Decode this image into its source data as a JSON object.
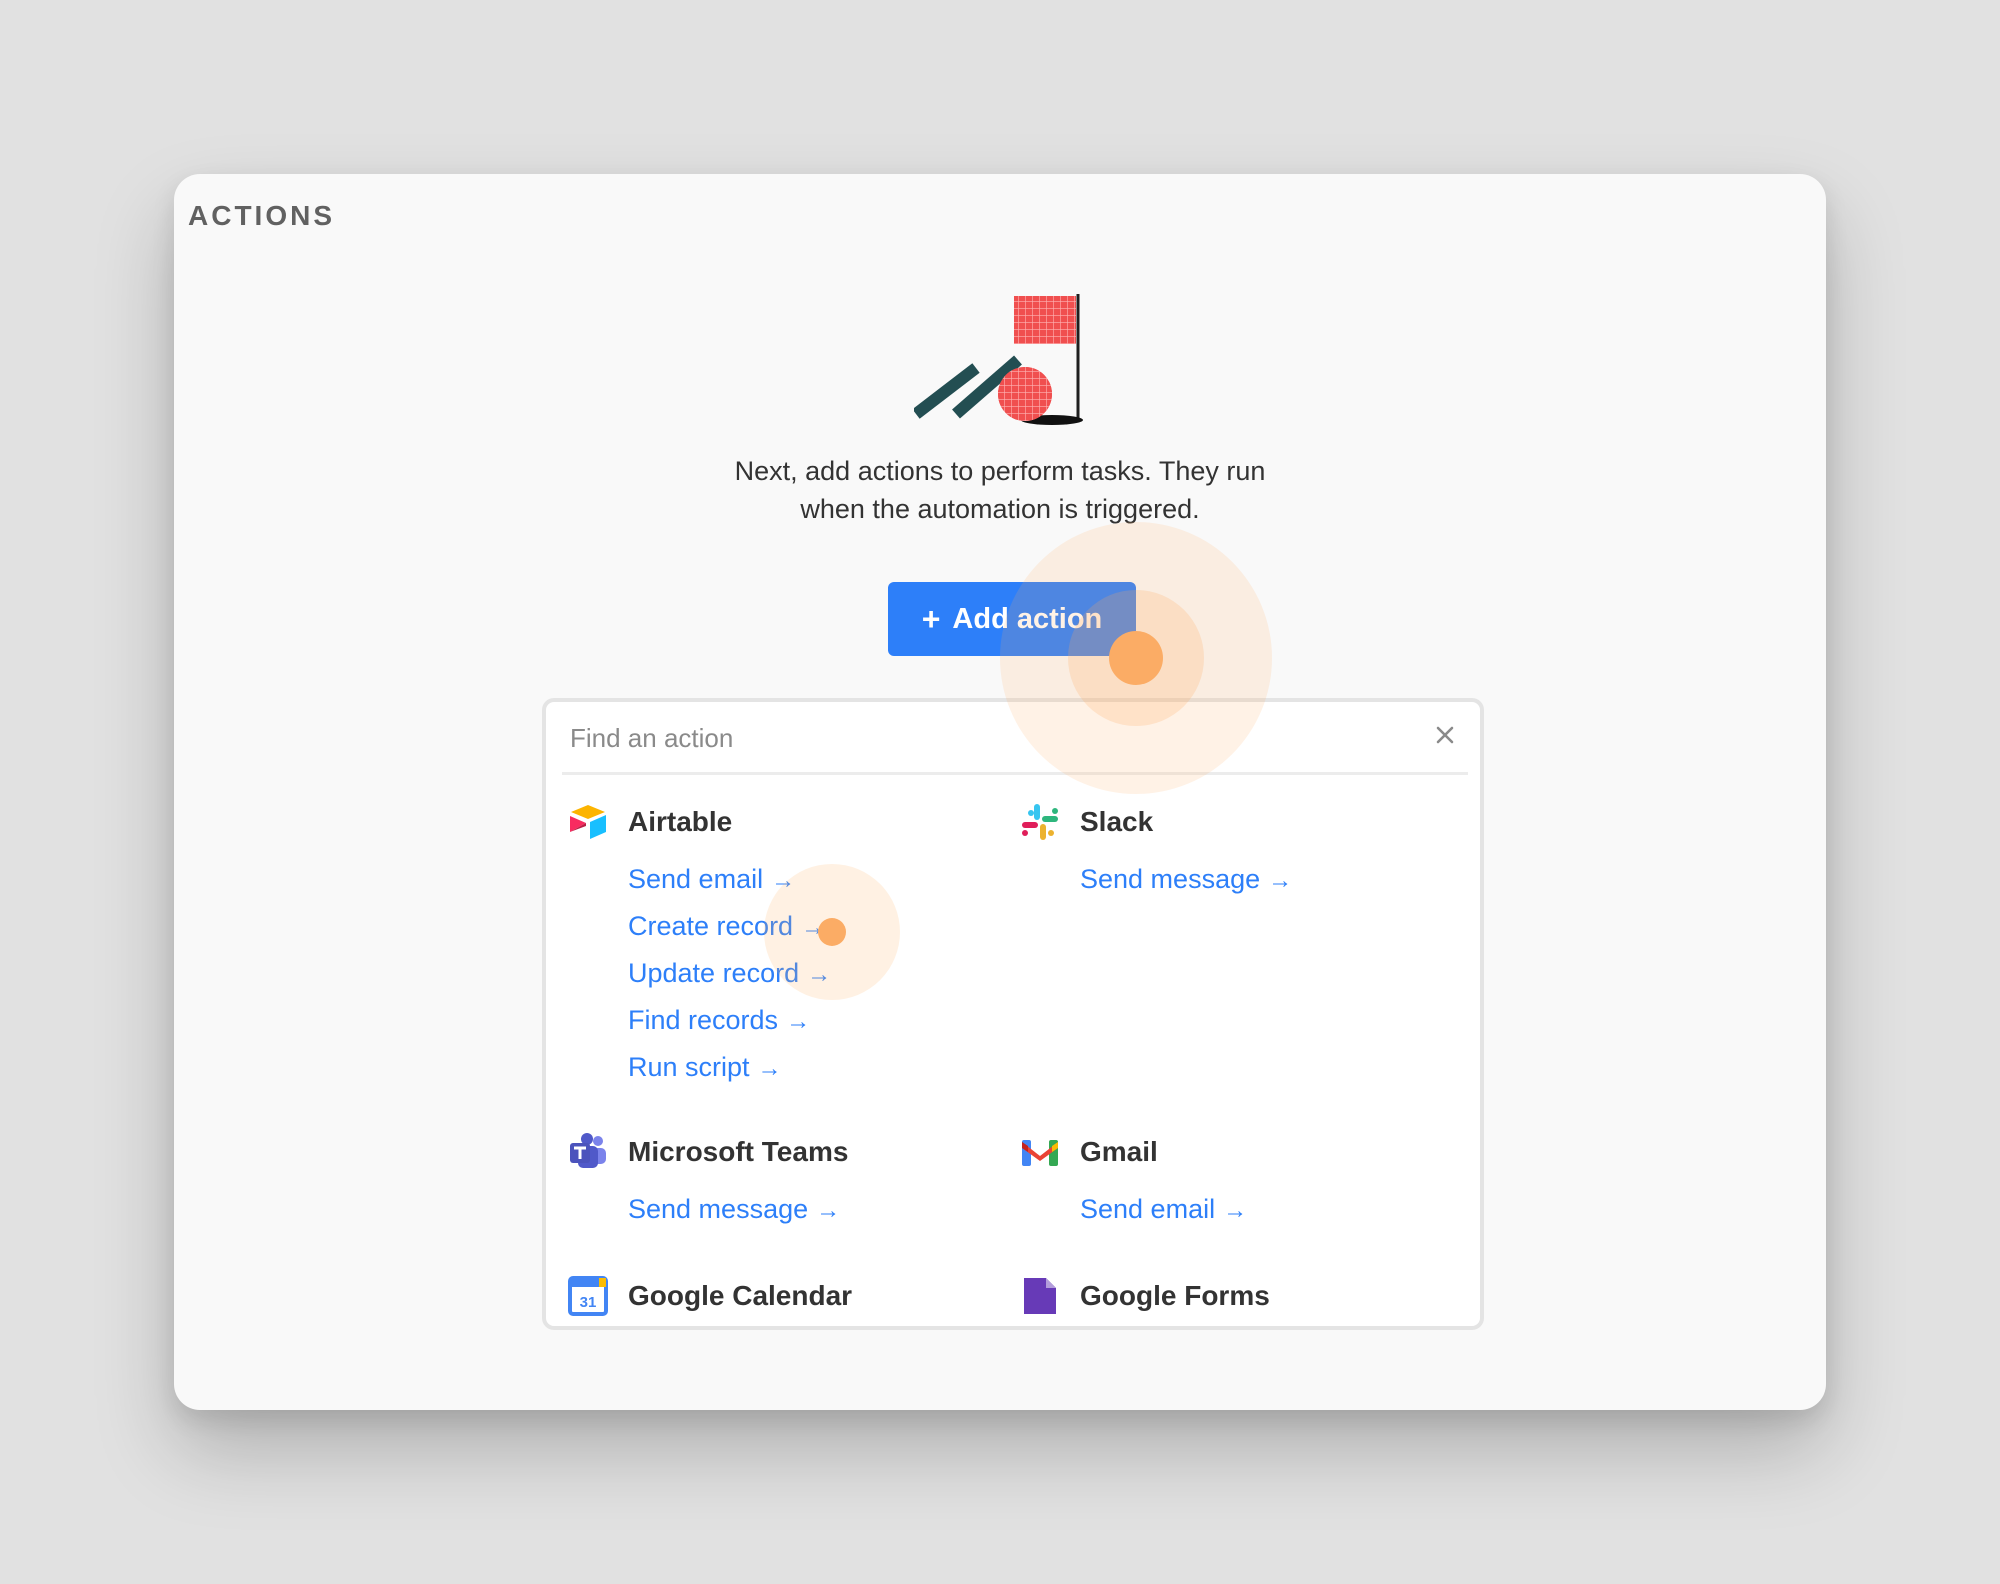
{
  "section": {
    "title": "ACTIONS"
  },
  "intro": {
    "line1": "Next, add actions to perform tasks. They run",
    "line2": "when the automation is triggered."
  },
  "add_button": {
    "label": "Add action"
  },
  "search": {
    "placeholder": "Find an action",
    "value": ""
  },
  "groups": [
    {
      "name": "Airtable",
      "icon": "airtable-icon",
      "actions": [
        "Send email",
        "Create record",
        "Update record",
        "Find records",
        "Run script"
      ]
    },
    {
      "name": "Slack",
      "icon": "slack-icon",
      "actions": [
        "Send message"
      ]
    },
    {
      "name": "Microsoft Teams",
      "icon": "microsoft-teams-icon",
      "actions": [
        "Send message"
      ]
    },
    {
      "name": "Gmail",
      "icon": "gmail-icon",
      "actions": [
        "Send email"
      ]
    },
    {
      "name": "Google Calendar",
      "icon": "google-calendar-icon",
      "actions": []
    },
    {
      "name": "Google Forms",
      "icon": "google-forms-icon",
      "actions": []
    }
  ],
  "arrow": "→",
  "calendar_icon_text": "31",
  "colors": {
    "accent": "#2d7ff9",
    "click_highlight": "#fbac65"
  }
}
